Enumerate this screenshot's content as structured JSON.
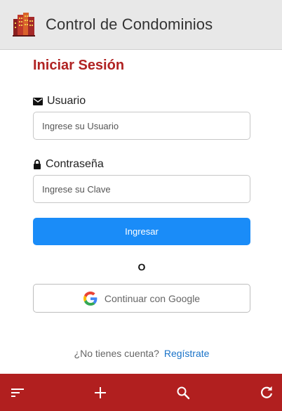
{
  "header": {
    "title": "Control de Condominios",
    "logo_icon": "buildings-logo",
    "background": "#e8e8e8"
  },
  "login": {
    "title": "Iniciar Sesión",
    "title_color": "#b02323",
    "user_label": "Usuario",
    "user_icon": "mail-icon",
    "user_placeholder": "Ingrese su Usuario",
    "user_value": "",
    "password_label": "Contraseña",
    "password_icon": "lock-icon",
    "password_placeholder": "Ingrese su Clave",
    "password_value": "",
    "submit_label": "Ingresar",
    "submit_color": "#1a8cf8",
    "separator": "O",
    "google_label": "Continuar con Google",
    "google_icon": "google-icon",
    "signup_question": "¿No tienes cuenta?",
    "signup_link": "Regístrate"
  },
  "bottom_bar": {
    "background": "#b11f1f",
    "items": [
      {
        "name": "menu",
        "icon": "sort-menu-icon"
      },
      {
        "name": "add",
        "icon": "plus-icon"
      },
      {
        "name": "search",
        "icon": "search-icon"
      },
      {
        "name": "refresh",
        "icon": "refresh-icon"
      }
    ]
  }
}
